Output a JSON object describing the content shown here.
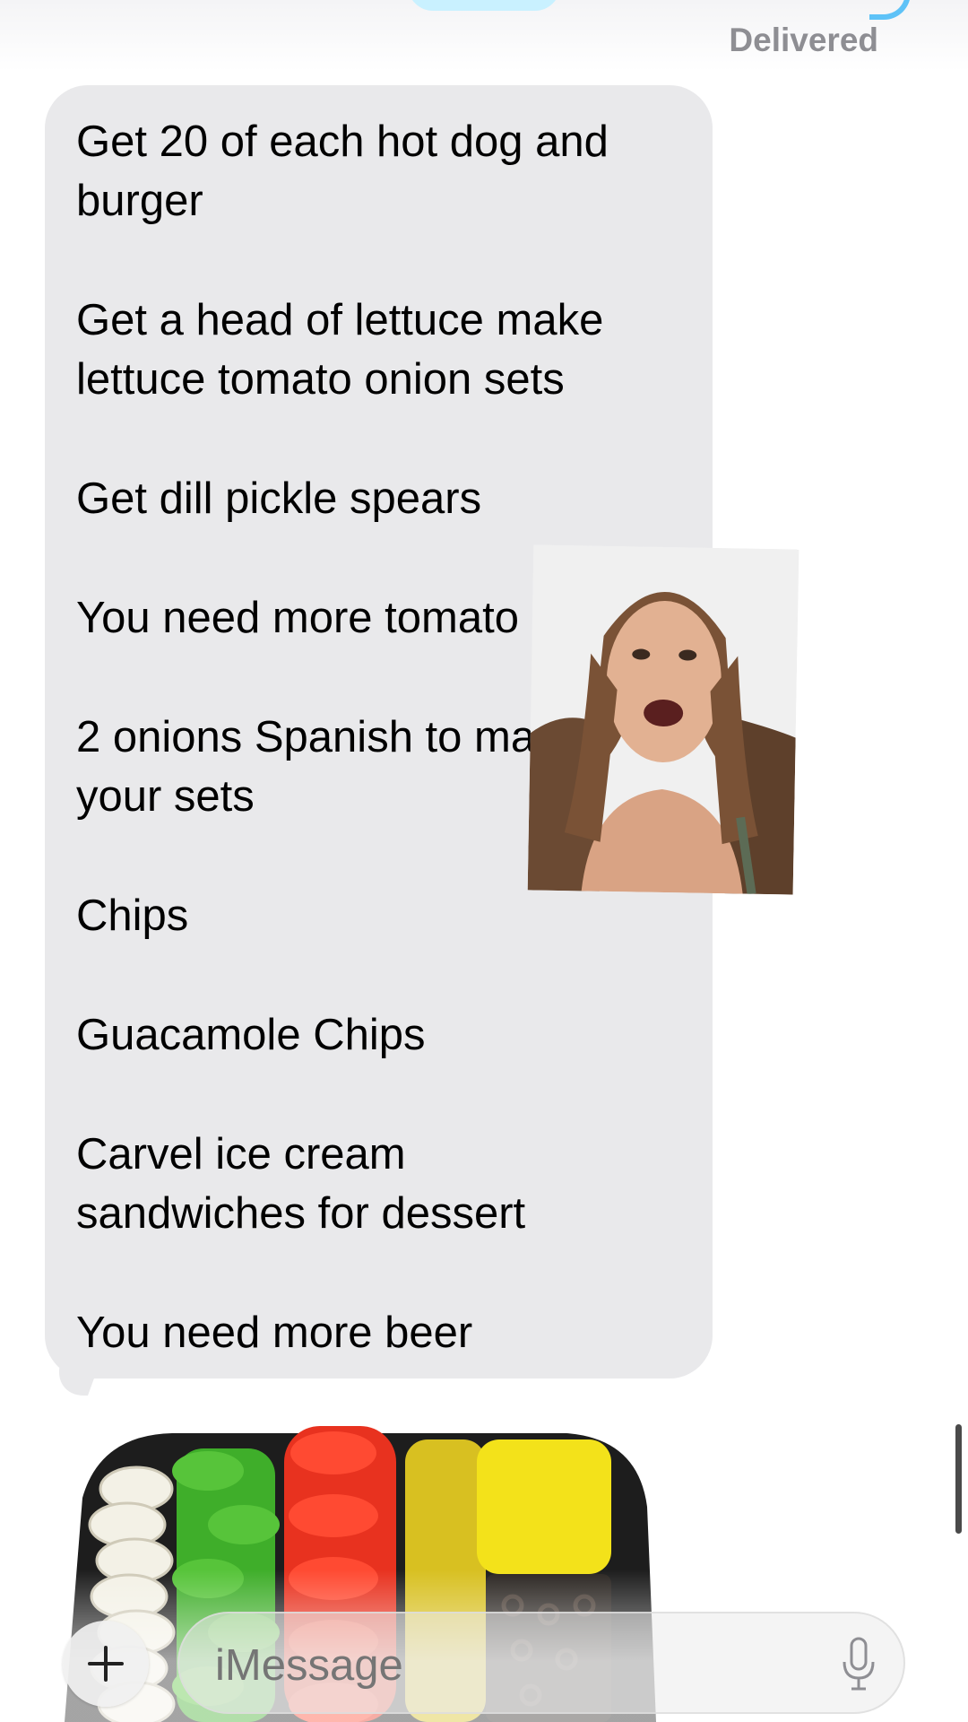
{
  "status": {
    "delivered": "Delivered"
  },
  "incoming_message": {
    "lines": [
      "Get 20 of each hot dog and\nburger",
      "Get a head of lettuce make\nlettuce tomato onion sets",
      "Get dill pickle spears",
      "You need more tomato",
      "2 onions Spanish to make\nyour sets",
      "Chips",
      "Guacamole Chips",
      "Carvel ice cream\nsandwiches for dessert",
      "You need more beer"
    ]
  },
  "compose": {
    "placeholder": "iMessage",
    "plus_icon": "plus-icon",
    "mic_icon": "microphone-icon"
  },
  "colors": {
    "incoming_bubble": "#e9e9eb",
    "outgoing_bubble": "#5ec2f7",
    "status_text": "#8e8e93"
  }
}
